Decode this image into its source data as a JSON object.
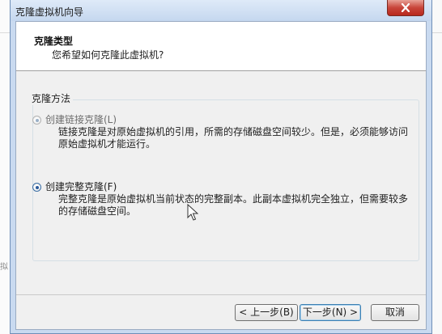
{
  "background": {
    "side_text": "拟"
  },
  "window": {
    "title": "克隆虚拟机向导"
  },
  "header": {
    "title": "克隆类型",
    "subtitle": "您希望如何克隆此虚拟机?"
  },
  "clone_method": {
    "group_label": "克隆方法",
    "options": [
      {
        "label": "创建链接克隆(L)",
        "description": "链接克隆是对原始虚拟机的引用，所需的存储磁盘空间较少。但是，必须能够访问原始虚拟机才能运行。",
        "selected": false,
        "enabled": false
      },
      {
        "label": "创建完整克隆(F)",
        "description": "完整克隆是原始虚拟机当前状态的完整副本。此副本虚拟机完全独立，但需要较多的存储磁盘空间。",
        "selected": true,
        "enabled": true
      }
    ]
  },
  "buttons": {
    "back": "< 上一步(B)",
    "next": "下一步(N) >",
    "cancel": "取消"
  },
  "colors": {
    "title_gradient": "#c5d7ef",
    "close_button": "#c8453a",
    "content_bg": "#f0f0f0",
    "default_button_border": "#3c7fb1"
  },
  "icons": {
    "close": "close-icon",
    "radio_selected": "radio-selected-icon",
    "radio_unselected": "radio-unselected-icon",
    "cursor": "mouse-cursor-icon"
  }
}
